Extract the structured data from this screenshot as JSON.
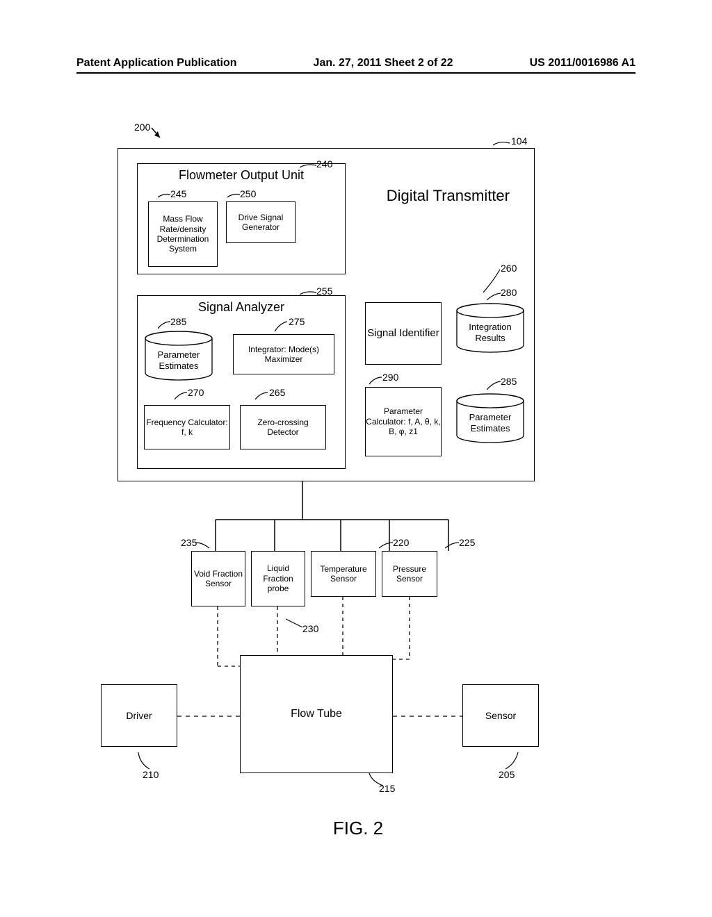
{
  "header": {
    "left": "Patent Application Publication",
    "center": "Jan. 27, 2011  Sheet 2 of 22",
    "right": "US 2011/0016986 A1"
  },
  "refs": {
    "r200": "200",
    "r104": "104",
    "r240": "240",
    "r245": "245",
    "r250": "250",
    "r255": "255",
    "r260": "260",
    "r280": "280",
    "r285a": "285",
    "r275": "275",
    "r270": "270",
    "r265": "265",
    "r290": "290",
    "r285b": "285",
    "r235": "235",
    "r230": "230",
    "r220": "220",
    "r225": "225",
    "r210": "210",
    "r215": "215",
    "r205": "205"
  },
  "titles": {
    "digital_transmitter": "Digital Transmitter",
    "flowmeter_output": "Flowmeter Output Unit",
    "signal_analyzer": "Signal Analyzer",
    "fig": "FIG. 2"
  },
  "blocks": {
    "mass_flow": "Mass Flow Rate/density Determination System",
    "drive_signal": "Drive Signal Generator",
    "signal_identifier": "Signal Identifier",
    "integration_results": "Integration Results",
    "parameter_estimates_a": "Parameter Estimates",
    "integrator": "Integrator:  Mode(s) Maximizer",
    "freq_calc": "Frequency Calculator: f, k",
    "zero_cross": "Zero-crossing Detector",
    "param_calc": "Parameter Calculator: f, A, θ, k, B, φ, z1",
    "parameter_estimates_b": "Parameter Estimates",
    "void_fraction": "Void Fraction Sensor",
    "liquid_fraction": "Liquid Fraction probe",
    "temp_sensor": "Temperature Sensor",
    "pressure_sensor": "Pressure Sensor",
    "driver": "Driver",
    "flow_tube": "Flow Tube",
    "sensor": "Sensor"
  }
}
